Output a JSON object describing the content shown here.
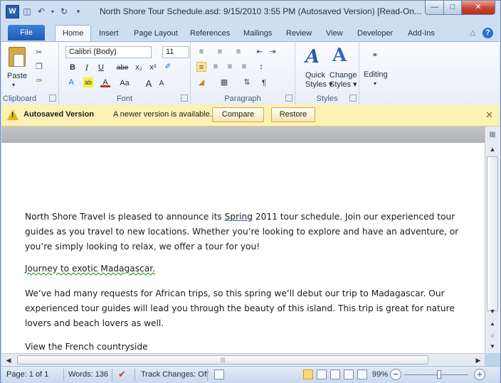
{
  "window": {
    "app_icon": "W",
    "title": "North Shore Tour Schedule.asd: 9/15/2010 3:55 PM (Autosaved Version)  [Read-On..."
  },
  "tabs": {
    "file": "File",
    "items": [
      "Home",
      "Insert",
      "Page Layout",
      "References",
      "Mailings",
      "Review",
      "View",
      "Developer",
      "Add-Ins"
    ]
  },
  "ribbon": {
    "clipboard": {
      "label": "Clipboard",
      "paste": "Paste"
    },
    "font": {
      "label": "Font",
      "font_name": "Calibri (Body)",
      "font_size": "11",
      "bold": "B",
      "italic": "I",
      "underline": "U",
      "strike": "abe",
      "sub": "x₂",
      "sup": "x²",
      "case": "Aa",
      "grow": "A",
      "shrink": "A"
    },
    "paragraph": {
      "label": "Paragraph",
      "pilcrow": "¶"
    },
    "styles": {
      "label": "Styles",
      "quick_styles": "Quick Styles",
      "change_styles": "Change Styles"
    },
    "editing": {
      "label": "Editing"
    }
  },
  "message_bar": {
    "title": "Autosaved Version",
    "text": "A newer version is available.",
    "compare": "Compare",
    "restore": "Restore"
  },
  "document": {
    "paragraphs": [
      {
        "lines": [
          "North Shore Travel is pleased to announce its Spring 2011 tour schedule.  Join our experienced tour",
          "guides as you travel to new locations. Whether you’re looking to explore and have an adventure, or",
          "you’re simply looking to relax, we offer a tour for you!"
        ]
      },
      {
        "lines": [
          "Journey to exotic Madagascar."
        ]
      },
      {
        "lines": [
          "We’ve had many requests for African trips, so this spring we’ll debut our trip to Madagascar. Our",
          "experienced tour guides will lead you through the beauty of this island. This trip is great for nature",
          "lovers and beach lovers as well."
        ]
      },
      {
        "lines": [
          "View the French countryside"
        ]
      }
    ]
  },
  "status_bar": {
    "page": "Page: 1 of 1",
    "words": "Words: 136",
    "track_changes": "Track Changes: Off",
    "zoom": "99%"
  }
}
